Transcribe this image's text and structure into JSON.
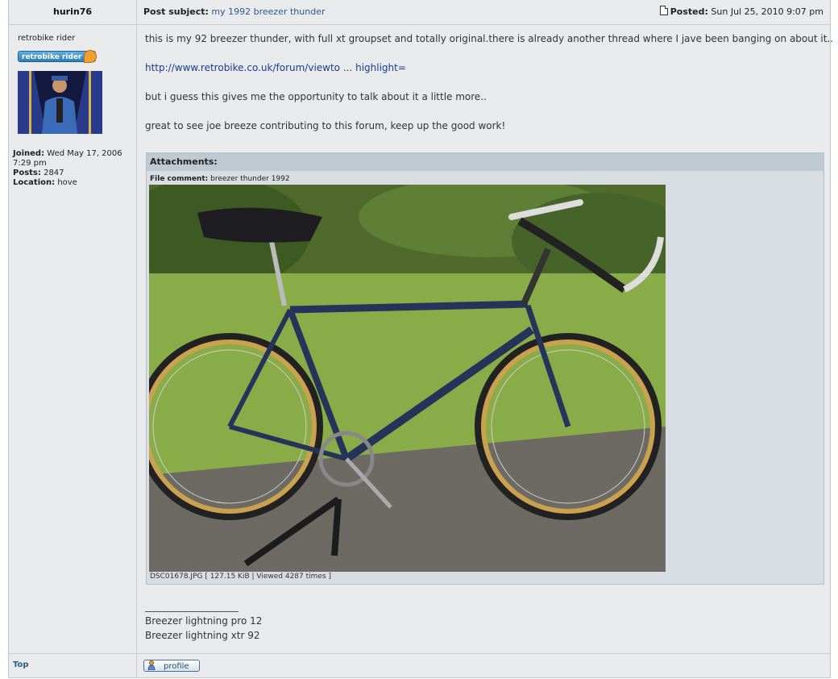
{
  "author": {
    "name": "hurin76",
    "rank_text": "retrobike rider",
    "rank_badge": "retrobike rider",
    "joined_label": "Joined:",
    "joined_value": "Wed May 17, 2006 7:29 pm",
    "posts_label": "Posts:",
    "posts_value": "2847",
    "location_label": "Location:",
    "location_value": "hove"
  },
  "post": {
    "subject_label": "Post subject:",
    "subject": "my 1992 breezer thunder",
    "posted_label": "Posted:",
    "posted_value": "Sun Jul 25, 2010 9:07 pm",
    "line1": "this is my 92 breezer thunder, with full xt groupset and totally original.there is already another thread where I jave been banging on about it..",
    "link": "http://www.retrobike.co.uk/forum/viewto ... highlight=",
    "line2": "but i guess this gives me the opportunity to talk about it a little more..",
    "line3": "great to see joe breeze contributing to this forum, keep up the good work!"
  },
  "attachment": {
    "header": "Attachments:",
    "comment_label": "File comment:",
    "comment_value": "breezer thunder 1992",
    "file_meta": "DSC01678.JPG [ 127.15 KiB | Viewed 4287 times ]"
  },
  "signature": {
    "line1": "Breezer lightning pro 12",
    "line2": "Breezer lightning xtr 92"
  },
  "footer": {
    "top_link": "Top",
    "profile_button": "profile"
  }
}
